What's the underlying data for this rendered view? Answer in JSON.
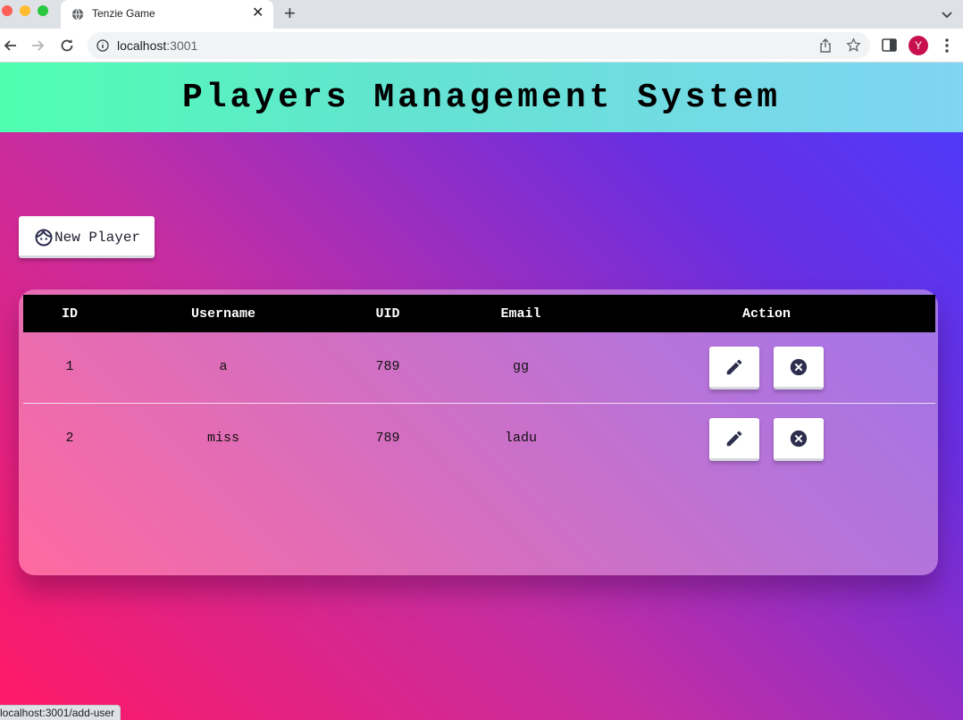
{
  "browser": {
    "tab_title": "Tenzie Game",
    "new_tab": "+",
    "tab_close": "✕",
    "url_host": "localhost",
    "url_port": ":3001",
    "avatar_letter": "Y",
    "status_url": "localhost:3001/add-user"
  },
  "page": {
    "title": "Players Management System",
    "new_player_label": "New Player"
  },
  "table": {
    "columns": [
      "ID",
      "Username",
      "UID",
      "Email",
      "Action"
    ],
    "rows": [
      {
        "id": "1",
        "username": "a",
        "uid": "789",
        "email": "gg"
      },
      {
        "id": "2",
        "username": "miss",
        "uid": "789",
        "email": "ladu"
      }
    ]
  },
  "colors": {
    "header_gradient": [
      "#4fffb0",
      "#80d4f4"
    ],
    "background_gradient": [
      "#ff1865",
      "#4b3cff"
    ],
    "icon_color": "#2d2d4e",
    "avatar": "#c8104e"
  },
  "icons": [
    "globe-icon",
    "close-icon",
    "plus-icon",
    "chevron-down-icon",
    "back-arrow-icon",
    "forward-arrow-icon",
    "reload-icon",
    "info-icon",
    "share-icon",
    "star-icon",
    "side-panel-icon",
    "kebab-menu-icon",
    "face-icon",
    "edit-pencil-icon",
    "delete-x-circle-icon"
  ]
}
